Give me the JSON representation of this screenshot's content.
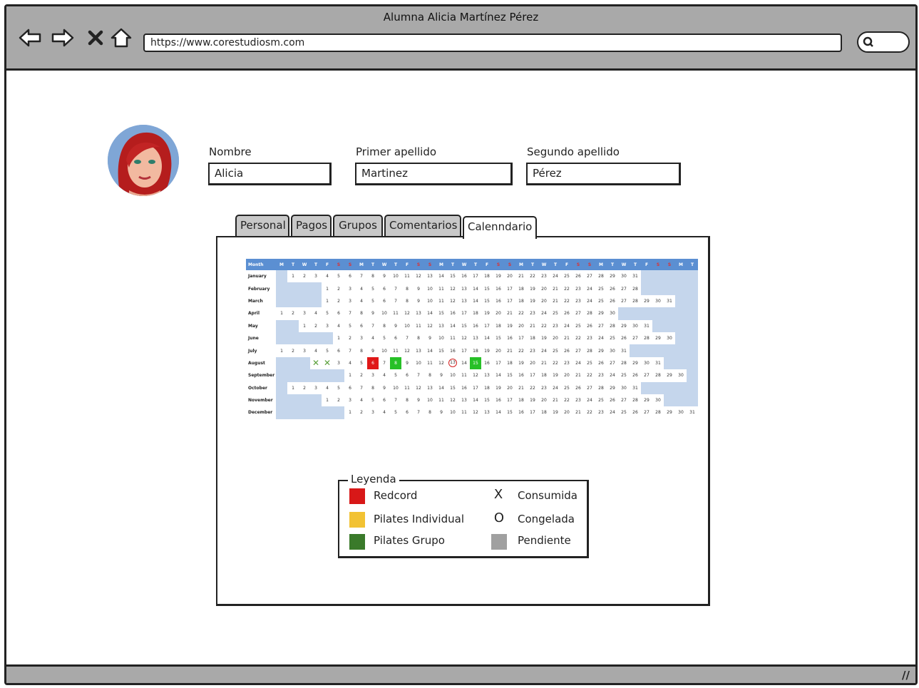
{
  "window": {
    "title": "Alumna Alicia Martínez Pérez",
    "url": "https://www.corestudiosm.com"
  },
  "form": {
    "nombre_label": "Nombre",
    "nombre_value": "Alicia",
    "apellido1_label": "Primer apellido",
    "apellido1_value": "Martinez",
    "apellido2_label": "Segundo apellido",
    "apellido2_value": "Pérez"
  },
  "tabs": [
    "Personal",
    "Pagos",
    "Grupos",
    "Comentarios",
    "Calenndario"
  ],
  "active_tab": "Calenndario",
  "calendar": {
    "header": [
      "Month",
      "M",
      "T",
      "W",
      "T",
      "F",
      "S",
      "S",
      "M",
      "T",
      "W",
      "T",
      "F",
      "S",
      "S",
      "M",
      "T",
      "W",
      "T",
      "F",
      "S",
      "S",
      "M",
      "T",
      "W",
      "T",
      "F",
      "S",
      "S",
      "M",
      "T",
      "W",
      "T",
      "F",
      "S",
      "S",
      "M",
      "T"
    ],
    "months": [
      {
        "name": "January",
        "offset": 1,
        "days": 31
      },
      {
        "name": "February",
        "offset": 4,
        "days": 28
      },
      {
        "name": "March",
        "offset": 4,
        "days": 31
      },
      {
        "name": "April",
        "offset": 0,
        "days": 30
      },
      {
        "name": "May",
        "offset": 2,
        "days": 31
      },
      {
        "name": "June",
        "offset": 5,
        "days": 30
      },
      {
        "name": "July",
        "offset": 0,
        "days": 31
      },
      {
        "name": "August",
        "offset": 3,
        "days": 31
      },
      {
        "name": "September",
        "offset": 6,
        "days": 30
      },
      {
        "name": "October",
        "offset": 1,
        "days": 31
      },
      {
        "name": "November",
        "offset": 4,
        "days": 30
      },
      {
        "name": "December",
        "offset": 6,
        "days": 31
      }
    ],
    "marks": {
      "August": {
        "1": "x",
        "2": "x",
        "6": "red",
        "8": "green",
        "13": "circle",
        "15": "green"
      }
    }
  },
  "legend": {
    "title": "Leyenda",
    "items": [
      {
        "label": "Redcord",
        "color": "#d81818"
      },
      {
        "label": "Pilates Individual",
        "color": "#f2c233"
      },
      {
        "label": "Pilates Grupo",
        "color": "#3a7a2a"
      }
    ],
    "states": [
      {
        "symbol": "X",
        "label": "Consumida"
      },
      {
        "symbol": "O",
        "label": "Congelada"
      },
      {
        "symbol": "",
        "label": "Pendiente",
        "color": "#a0a0a0"
      }
    ]
  }
}
